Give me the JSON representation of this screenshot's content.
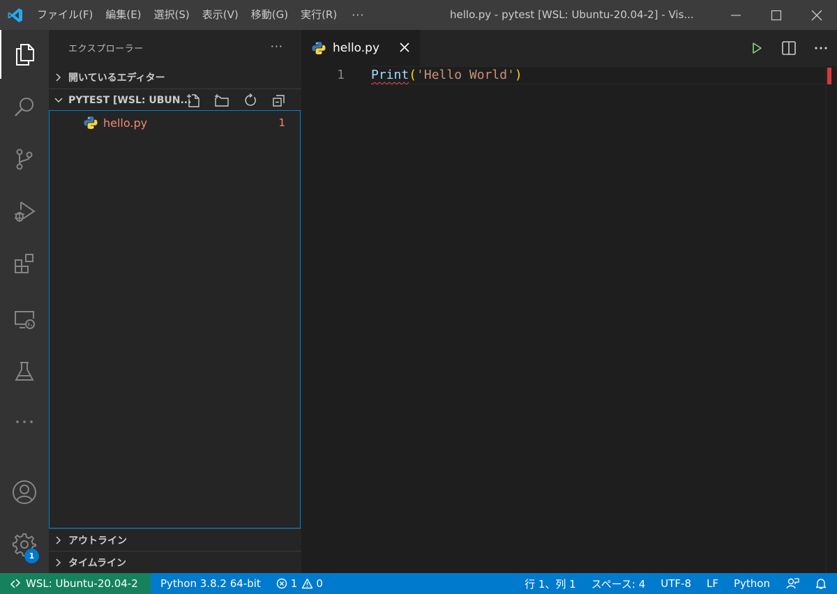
{
  "titlebar": {
    "menu": [
      "ファイル(F)",
      "編集(E)",
      "選択(S)",
      "表示(V)",
      "移動(G)",
      "実行(R)"
    ],
    "more": "···",
    "title": "hello.py - pytest [WSL: Ubuntu-20.04-2] - Vis..."
  },
  "activitybar": {
    "settings_badge": "1"
  },
  "sidebar": {
    "title": "エクスプローラー",
    "more": "···",
    "open_editors": "開いているエディター",
    "folder": "PYTEST [WSL: UBUN...",
    "file": {
      "name": "hello.py",
      "problems": "1"
    },
    "outline": "アウトライン",
    "timeline": "タイムライン"
  },
  "editor": {
    "tab": "hello.py",
    "line_number": "1",
    "code": {
      "fn": "Print",
      "open": "(",
      "str": "'Hello World'",
      "close": ")"
    }
  },
  "statusbar": {
    "remote": "WSL: Ubuntu-20.04-2",
    "interpreter": "Python 3.8.2 64-bit",
    "errors": "1",
    "warnings": "0",
    "position": "行 1、列 1",
    "spaces": "スペース: 4",
    "encoding": "UTF-8",
    "eol": "LF",
    "language": "Python"
  },
  "colors": {
    "accent": "#007acc",
    "remote": "#16825d",
    "error": "#f48771"
  }
}
